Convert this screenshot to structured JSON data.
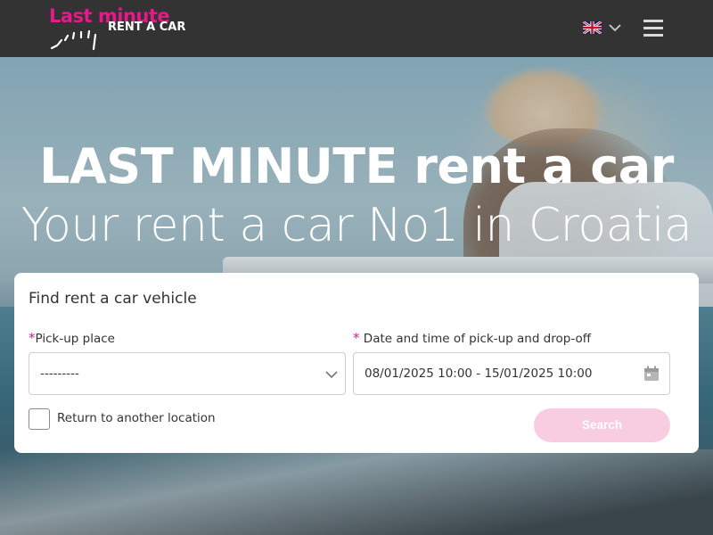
{
  "header": {
    "logo": {
      "line1": "Last minute",
      "line2": "RENT A CAR"
    },
    "language": {
      "selected": "en",
      "icon": "uk-flag-icon"
    },
    "menu_icon": "hamburger-icon"
  },
  "hero": {
    "title": "LAST MINUTE rent a car",
    "subtitle": "Your rent a car No1 in Croatia"
  },
  "search": {
    "title": "Find rent a car vehicle",
    "required_marker": "*",
    "pickup_label": "Pick-up place",
    "pickup_value": "---------",
    "date_label": "Date and time of pick-up and drop-off",
    "date_value": "08/01/2025 10:00 - 15/01/2025 10:00",
    "return_label": "Return to another location",
    "return_checked": false,
    "search_button": "Search"
  },
  "colors": {
    "brand": "#e8178a",
    "header_bg": "#333333",
    "button_disabled": "#f8cde2"
  }
}
